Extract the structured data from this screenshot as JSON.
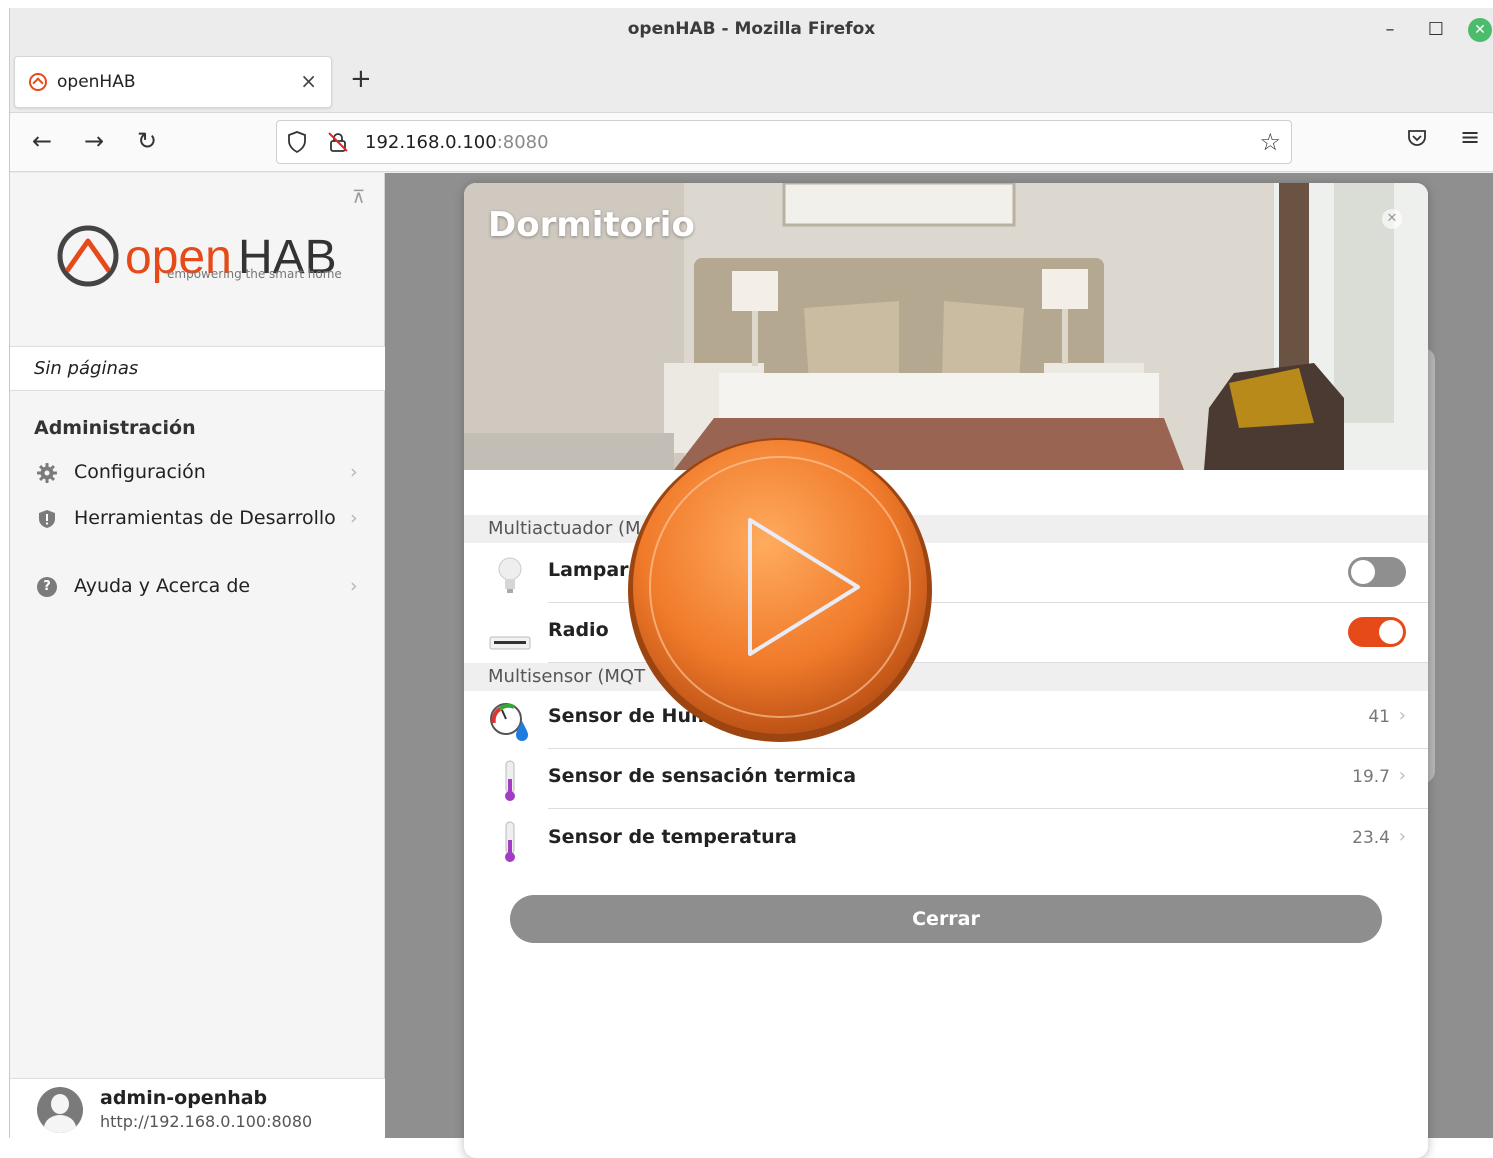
{
  "window": {
    "title": "openHAB - Mozilla Firefox"
  },
  "tab": {
    "label": "openHAB",
    "close": "×",
    "new_tab": "+"
  },
  "nav": {
    "back": "←",
    "forward": "→",
    "reload": "↻",
    "url_host": "192.168.0.100",
    "url_port": ":8080",
    "star": "☆",
    "menu": "≡"
  },
  "sidebar": {
    "logo_text_open": "open",
    "logo_text_hab": "HAB",
    "logo_tagline": "empowering the smart home",
    "no_pages": "Sin páginas",
    "section_title": "Administración",
    "items": [
      {
        "label": "Configuración",
        "icon": "gear-icon"
      },
      {
        "label": "Herramientas de Desarrollo",
        "icon": "shield-icon"
      },
      {
        "label": "Ayuda y Acerca de",
        "icon": "help-icon",
        "glyph": "?"
      }
    ],
    "chevron": "›",
    "user": {
      "name": "admin-openhab",
      "url": "http://192.168.0.100:8080"
    }
  },
  "modal": {
    "title": "Dormitorio",
    "groups": [
      {
        "label": "Multiactuador (M"
      },
      {
        "label": "Multisensor (MQT"
      }
    ],
    "rows": [
      {
        "label": "Lampara",
        "icon": "lightbulb-icon",
        "state": "off"
      },
      {
        "label": "Radio",
        "icon": "radio-icon",
        "state": "on"
      },
      {
        "label": "Sensor de Hum",
        "icon": "humidity-icon",
        "value": "41"
      },
      {
        "label": "Sensor de sensación termica",
        "icon": "thermometer-icon",
        "value": "19.7"
      },
      {
        "label": "Sensor de temperatura",
        "icon": "thermometer-icon",
        "value": "23.4"
      }
    ],
    "close_button": "Cerrar"
  },
  "colors": {
    "accent": "#e64a19",
    "play_overlay": "#f07a2a"
  }
}
